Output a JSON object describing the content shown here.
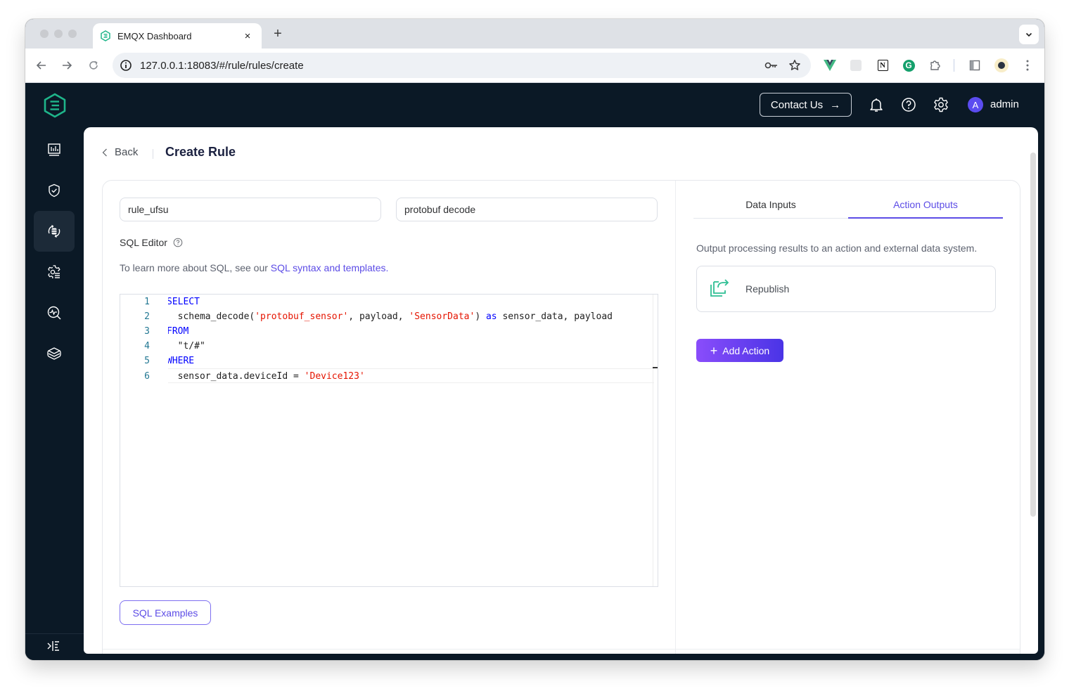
{
  "browser": {
    "tab_title": "EMQX Dashboard",
    "tab_close": "×",
    "new_tab": "+",
    "url": "127.0.0.1:18083/#/rule/rules/create",
    "icons": {
      "back": "back-arrow-icon",
      "forward": "forward-arrow-icon",
      "reload": "reload-icon",
      "site_info": "info-icon",
      "password": "key-icon",
      "bookmark": "star-icon",
      "extensions": [
        "vue-devtools-icon",
        "extension-grey-icon",
        "notion-icon",
        "grammarly-icon",
        "puzzle-icon"
      ],
      "side_panel": "side-panel-icon",
      "profile": "profile-avatar-icon",
      "menu": "kebab-menu-icon"
    }
  },
  "header": {
    "contact_label": "Contact Us",
    "contact_arrow": "→",
    "avatar_letter": "A",
    "username": "admin",
    "icons": [
      "bell-icon",
      "help-icon",
      "gear-icon"
    ]
  },
  "sidebar": {
    "items": [
      {
        "name": "dashboard",
        "icon": "monitor-chart-icon",
        "active": false
      },
      {
        "name": "access-control",
        "icon": "shield-check-icon",
        "active": false
      },
      {
        "name": "integration",
        "icon": "data-cycle-icon",
        "active": true
      },
      {
        "name": "management",
        "icon": "gear-list-icon",
        "active": false
      },
      {
        "name": "diagnose",
        "icon": "search-pulse-icon",
        "active": false
      },
      {
        "name": "extensions",
        "icon": "layers-icon",
        "active": false
      }
    ],
    "collapse_icon": "collapse-sidebar-icon"
  },
  "page": {
    "back_label": "Back",
    "title": "Create Rule"
  },
  "form": {
    "rule_name": "rule_ufsu",
    "rule_note": "protobuf decode",
    "sql_editor_label": "SQL Editor",
    "hint_prefix": "To learn more about SQL, see our ",
    "hint_link": "SQL syntax and templates.",
    "sql_lines": [
      {
        "num": "1",
        "tokens": [
          {
            "t": "SELECT",
            "c": "kw"
          }
        ]
      },
      {
        "num": "2",
        "tokens": [
          {
            "t": "  schema_decode(",
            "c": ""
          },
          {
            "t": "'protobuf_sensor'",
            "c": "str"
          },
          {
            "t": ", payload, ",
            "c": ""
          },
          {
            "t": "'SensorData'",
            "c": "str"
          },
          {
            "t": ") ",
            "c": ""
          },
          {
            "t": "as",
            "c": "kw"
          },
          {
            "t": " sensor_data, payload",
            "c": ""
          }
        ]
      },
      {
        "num": "3",
        "tokens": [
          {
            "t": "FROM",
            "c": "kw"
          }
        ]
      },
      {
        "num": "4",
        "tokens": [
          {
            "t": "  \"t/#\"",
            "c": ""
          }
        ]
      },
      {
        "num": "5",
        "tokens": [
          {
            "t": "WHERE",
            "c": "kw"
          }
        ]
      },
      {
        "num": "6",
        "tokens": [
          {
            "t": "  sensor_data.deviceId = ",
            "c": ""
          },
          {
            "t": "'Device123'",
            "c": "str"
          }
        ]
      }
    ],
    "examples_button": "SQL Examples"
  },
  "right": {
    "tabs": [
      {
        "label": "Data Inputs",
        "active": false
      },
      {
        "label": "Action Outputs",
        "active": true
      }
    ],
    "description": "Output processing results to an action and external data system.",
    "actions": [
      {
        "name": "Republish",
        "icon": "republish-icon"
      }
    ],
    "add_action_label": "Add Action",
    "add_action_icon": "+"
  },
  "colors": {
    "brand_green": "#1fb58a",
    "accent_purple": "#5c4ce6",
    "header_bg": "#0b1926",
    "sql_keyword": "#0000ff",
    "sql_string": "#e51400"
  }
}
